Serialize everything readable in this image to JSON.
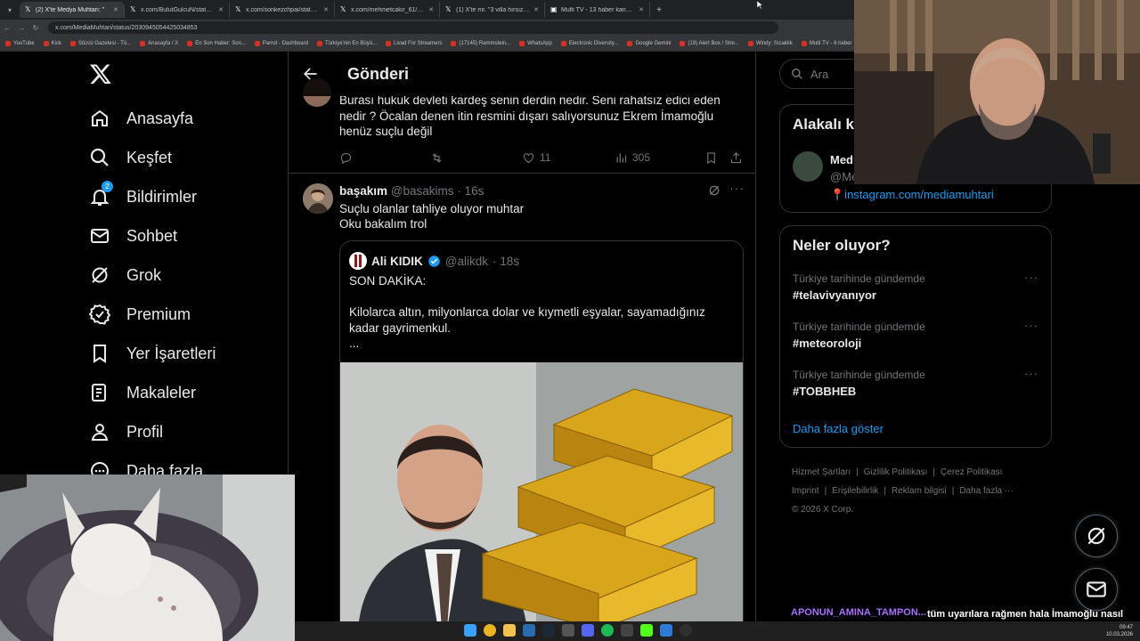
{
  "browser": {
    "tabs": [
      {
        "title": "(2) X'te Medya Muhtarı: \"",
        "active": true
      },
      {
        "title": "x.com/BulutGulcuN/status/203",
        "active": false
      },
      {
        "title": "x.com/sonkezchpai/status/203",
        "active": false
      },
      {
        "title": "x.com/mehmetcakir_61/status/",
        "active": false
      },
      {
        "title": "(1) X'te mr. \"3 villa hırsızlığını, Sı",
        "active": false
      },
      {
        "title": "Multi TV - 13 haber kanalını ay",
        "active": false
      }
    ],
    "url": "x.com/MediaMuhtari/status/2030945054425034853",
    "bookmarks": [
      "YouTube",
      "Kick",
      "Sözcü Gazetesi - Tü...",
      "Anasayfa / X",
      "En Son Haber: Son...",
      "Parrot - Dashboard",
      "Türkiye'nin En Büyü...",
      "Livad For Streamers",
      "(17145) Rammstein...",
      "WhatsApp",
      "Electronic Diversity...",
      "Google Gemini",
      "(19) Alert Box / Stre...",
      "Windy: Sıcaklık",
      "Multi TV - 6 haber"
    ]
  },
  "nav": {
    "items": [
      {
        "label": "Anasayfa",
        "icon": "home-icon"
      },
      {
        "label": "Keşfet",
        "icon": "search-icon"
      },
      {
        "label": "Bildirimler",
        "icon": "bell-icon",
        "badge": "2"
      },
      {
        "label": "Sohbet",
        "icon": "mail-icon"
      },
      {
        "label": "Grok",
        "icon": "grok-icon"
      },
      {
        "label": "Premium",
        "icon": "verified-icon"
      },
      {
        "label": "Yer İşaretleri",
        "icon": "bookmark-icon"
      },
      {
        "label": "Makaleler",
        "icon": "article-icon"
      },
      {
        "label": "Profil",
        "icon": "person-icon"
      },
      {
        "label": "Daha fazla",
        "icon": "more-icon"
      }
    ]
  },
  "main": {
    "header_title": "Gönderi",
    "reply1": {
      "text": "Burası hukuk devleti kardeş senin derdin nedir. Seni rahatsız edici eden nedir ? Öcalan denen itin resmini dışarı salıyorsunuz Ekrem İmamoğlu henüz suçlu değil",
      "likes": "11",
      "views": "305"
    },
    "reply2": {
      "name": "başakım",
      "handle": "@basakims",
      "time": "· 16s",
      "line1": "Suçlu olanlar tahliye oluyor muhtar",
      "line2": "Oku bakalım trol",
      "quote": {
        "name": "Ali KIDIK",
        "handle": "@alikdk",
        "time": "· 18s",
        "line1": "SON DAKİKA:",
        "line2": "Kilolarca altın, milyonlarca dolar ve kıymetli eşyalar, sayamadığınız kadar gayrimenkul.",
        "line3": "..."
      }
    }
  },
  "right": {
    "search_placeholder": "Ara",
    "related_title": "Alakalı k",
    "related_name": "Med",
    "related_handle": "@Me",
    "related_link": "📍instagram.com/mediamuhtari",
    "trends_title": "Neler oluyor?",
    "trends": [
      {
        "meta": "Türkiye tarihinde gündemde",
        "tag": "#telavivyanıyor"
      },
      {
        "meta": "Türkiye tarihinde gündemde",
        "tag": "#meteoroloji"
      },
      {
        "meta": "Türkiye tarihinde gündemde",
        "tag": "#TOBBHEB"
      }
    ],
    "show_more": "Daha fazla göster",
    "footer": [
      "Hizmet Şartları",
      "Gizlilik Politikası",
      "Çerez Politikası",
      "Imprint",
      "Erişilebilirlik",
      "Reklam bilgisi",
      "Daha fazla ···",
      "© 2026 X Corp."
    ]
  },
  "stream_chat": {
    "user": "APONUN_AMINA_TAMPON...",
    "message": "tüm uyarılara rağmen hala İmamoğlu nasıl konuşuyor gereği yapılsın"
  },
  "taskbar": {
    "time": "09:47",
    "date": "10.03.2026"
  },
  "colors": {
    "accent": "#1d9bf0",
    "chat_user": "#a970ff",
    "border": "#2f3336"
  }
}
